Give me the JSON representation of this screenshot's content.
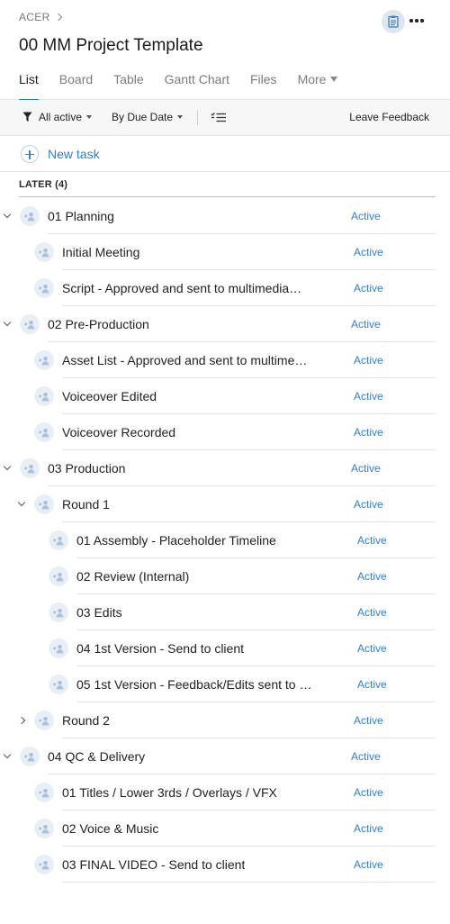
{
  "breadcrumb": {
    "label": "ACER"
  },
  "project": {
    "title": "00 MM Project Template"
  },
  "tabs": [
    {
      "label": "List"
    },
    {
      "label": "Board"
    },
    {
      "label": "Table"
    },
    {
      "label": "Gantt Chart"
    },
    {
      "label": "Files"
    },
    {
      "label": "More"
    }
  ],
  "toolbar": {
    "filter_label": "All active",
    "sort_label": "By Due Date",
    "feedback_label": "Leave Feedback"
  },
  "new_task": {
    "label": "New task"
  },
  "section": {
    "title": "LATER (4)"
  },
  "status_color": "#2f7fd1",
  "accent_color": "#2d7fd3",
  "tasks": [
    {
      "name": "01 Planning",
      "status": "Active",
      "level": 0,
      "toggle": "open"
    },
    {
      "name": "Initial Meeting",
      "status": "Active",
      "level": 1,
      "toggle": "none"
    },
    {
      "name": "Script - Approved and sent to multimedia…",
      "status": "Active",
      "level": 1,
      "toggle": "none"
    },
    {
      "name": "02 Pre-Production",
      "status": "Active",
      "level": 0,
      "toggle": "open"
    },
    {
      "name": "Asset List - Approved and sent to multime…",
      "status": "Active",
      "level": 1,
      "toggle": "none"
    },
    {
      "name": "Voiceover Edited",
      "status": "Active",
      "level": 1,
      "toggle": "none"
    },
    {
      "name": "Voiceover Recorded",
      "status": "Active",
      "level": 1,
      "toggle": "none"
    },
    {
      "name": "03 Production",
      "status": "Active",
      "level": 0,
      "toggle": "open"
    },
    {
      "name": "Round 1",
      "status": "Active",
      "level": 1,
      "toggle": "open"
    },
    {
      "name": "01 Assembly - Placeholder Timeline",
      "status": "Active",
      "level": 2,
      "toggle": "none"
    },
    {
      "name": "02 Review (Internal)",
      "status": "Active",
      "level": 2,
      "toggle": "none"
    },
    {
      "name": "03 Edits",
      "status": "Active",
      "level": 2,
      "toggle": "none"
    },
    {
      "name": "04 1st Version - Send to client",
      "status": "Active",
      "level": 2,
      "toggle": "none"
    },
    {
      "name": "05 1st Version - Feedback/Edits sent to …",
      "status": "Active",
      "level": 2,
      "toggle": "none"
    },
    {
      "name": "Round 2",
      "status": "Active",
      "level": 1,
      "toggle": "closed"
    },
    {
      "name": "04 QC & Delivery",
      "status": "Active",
      "level": 0,
      "toggle": "open"
    },
    {
      "name": "01 Titles / Lower 3rds / Overlays / VFX",
      "status": "Active",
      "level": 1,
      "toggle": "none"
    },
    {
      "name": "02 Voice & Music",
      "status": "Active",
      "level": 1,
      "toggle": "none"
    },
    {
      "name": "03 FINAL VIDEO - Send to client",
      "status": "Active",
      "level": 1,
      "toggle": "none"
    }
  ]
}
